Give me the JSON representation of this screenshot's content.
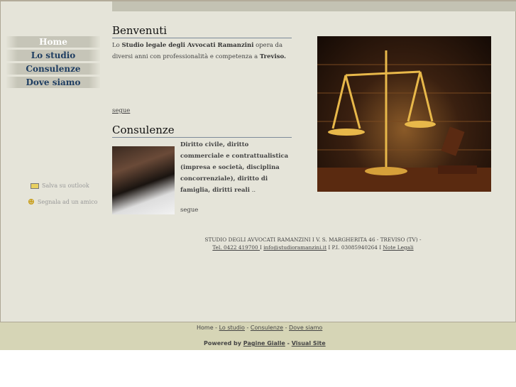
{
  "nav": [
    {
      "label": "Home"
    },
    {
      "label": "Lo studio"
    },
    {
      "label": "Consulenze"
    },
    {
      "label": "Dove siamo"
    }
  ],
  "welcome": {
    "title": "Benvenuti",
    "t1": "Lo ",
    "b1": "Studio legale degli Avvocati Ramanzini",
    "t2": " opera da diversi anni con professionalità e competenza a ",
    "b2": "Treviso.",
    "more": "segue"
  },
  "consulenze": {
    "title": "Consulenze",
    "text": "Diritto civile, diritto commerciale e contrattualistica (impresa e società, disciplina concorrenziale), diritto di famiglia, diritti reali",
    "ellipsis": " ..",
    "more": "segue"
  },
  "side": {
    "outlook": "Salva su outlook",
    "friend": "Segnala ad un amico"
  },
  "address": {
    "line1": "STUDIO DEGLI AVVOCATI RAMANZINI I V. S. MARGHERITA 46 - TREVISO (TV) -",
    "tel": "Tel. 0422 419700 ",
    "sep1": "I ",
    "email": "info@studioramanzini.it",
    "piva": " I P.I. 03085940264 I ",
    "legal": "Note Legali"
  },
  "footer": {
    "home": "Home",
    "sep": " - ",
    "studio": "Lo studio",
    "consulenze": "Consulenze",
    "dove": "Dove siamo",
    "powered": "Powered by ",
    "pg": "Pagine Gialle",
    "dash": " - ",
    "vs": "Visual Site"
  }
}
